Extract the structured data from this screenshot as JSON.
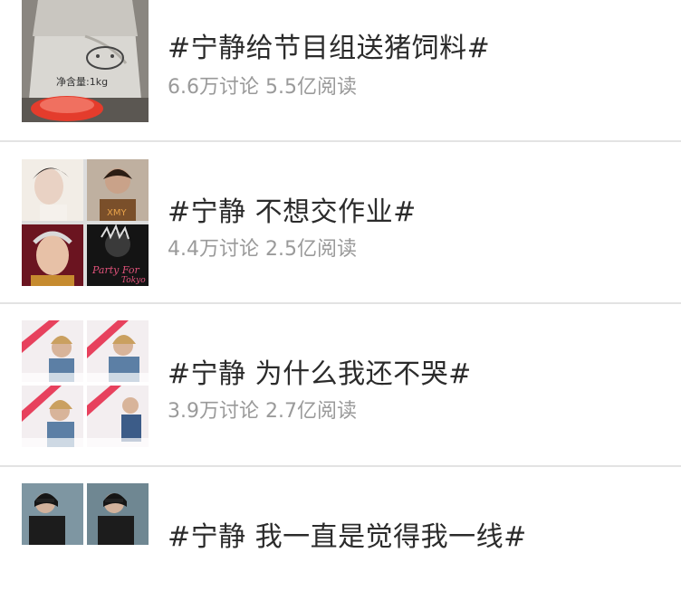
{
  "topics": [
    {
      "title": "#宁静给节目组送猪饲料#",
      "discussions": "6.6万讨论",
      "reads": "5.5亿阅读",
      "thumb_text": "净含量:1kg"
    },
    {
      "title": "#宁静 不想交作业#",
      "discussions": "4.4万讨论",
      "reads": "2.5亿阅读",
      "thumb_text": "Party For Tokyo"
    },
    {
      "title": "#宁静 为什么我还不哭#",
      "discussions": "3.9万讨论",
      "reads": "2.7亿阅读"
    },
    {
      "title": "#宁静 我一直是觉得我一线#"
    }
  ],
  "colors": {
    "title": "#2b2b2b",
    "meta": "#9a9a9a",
    "divider": "#e3e3e3"
  }
}
